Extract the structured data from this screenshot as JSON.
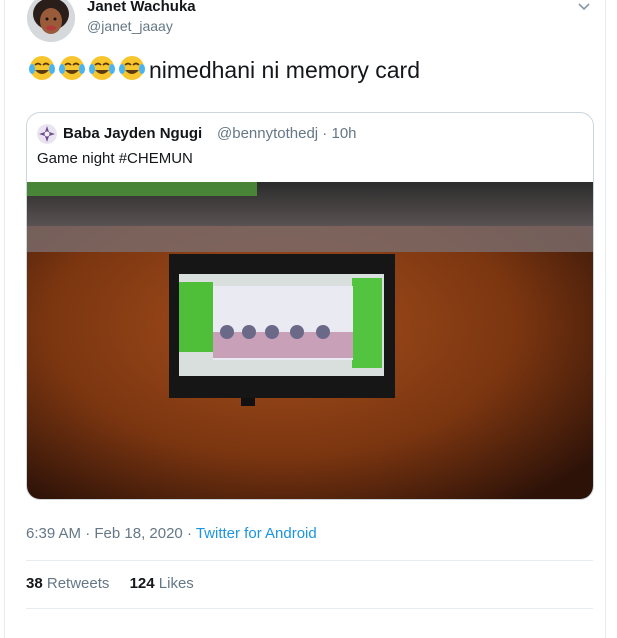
{
  "tweet": {
    "author_name": "Janet Wachuka",
    "author_handle": "@janet_jaaay",
    "text_emojis": [
      "face-with-tears-of-joy",
      "face-with-tears-of-joy",
      "face-with-tears-of-joy",
      "face-with-tears-of-joy"
    ],
    "text": "nimedhani ni memory card",
    "timestamp": "6:39 AM · Feb 18, 2020",
    "separator": " · ",
    "source": "Twitter for Android",
    "retweets_count": "38",
    "retweets_label": "Retweets",
    "likes_count": "124",
    "likes_label": "Likes"
  },
  "quoted_tweet": {
    "author_name": "Baba Jayden Ngugi",
    "author_handle": "@bennytothedj",
    "age": "10h",
    "dot": " · ",
    "text": "Game night #CHEMUN",
    "image": "photo-tv-on-orange-wall"
  },
  "icons": {
    "caret": "chevron-down-icon"
  },
  "colors": {
    "link": "#1b95e0",
    "secondary_text": "#657786",
    "border": "#ccd6dd"
  }
}
